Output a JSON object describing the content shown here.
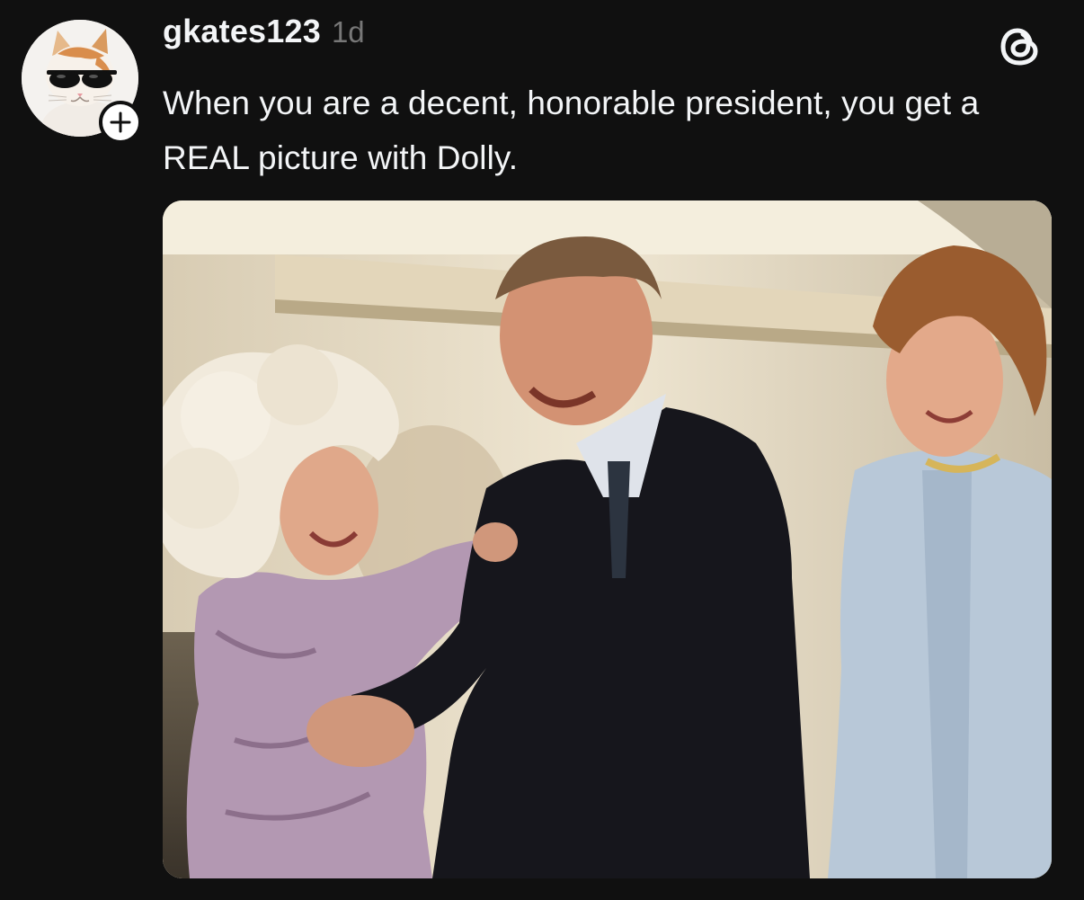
{
  "post": {
    "username": "gkates123",
    "timestamp": "1d",
    "text": "When you are a decent, honorable president, you get a REAL picture with Dolly.",
    "avatar_icon": "cat-with-sunglasses-avatar",
    "follow_icon": "plus-icon",
    "brand_icon": "threads-logo-icon",
    "image_description_icon": "photo"
  },
  "colors": {
    "background": "#101010",
    "text_primary": "#f3f5f7",
    "text_secondary": "#777777",
    "follow_badge": "#ffffff"
  }
}
